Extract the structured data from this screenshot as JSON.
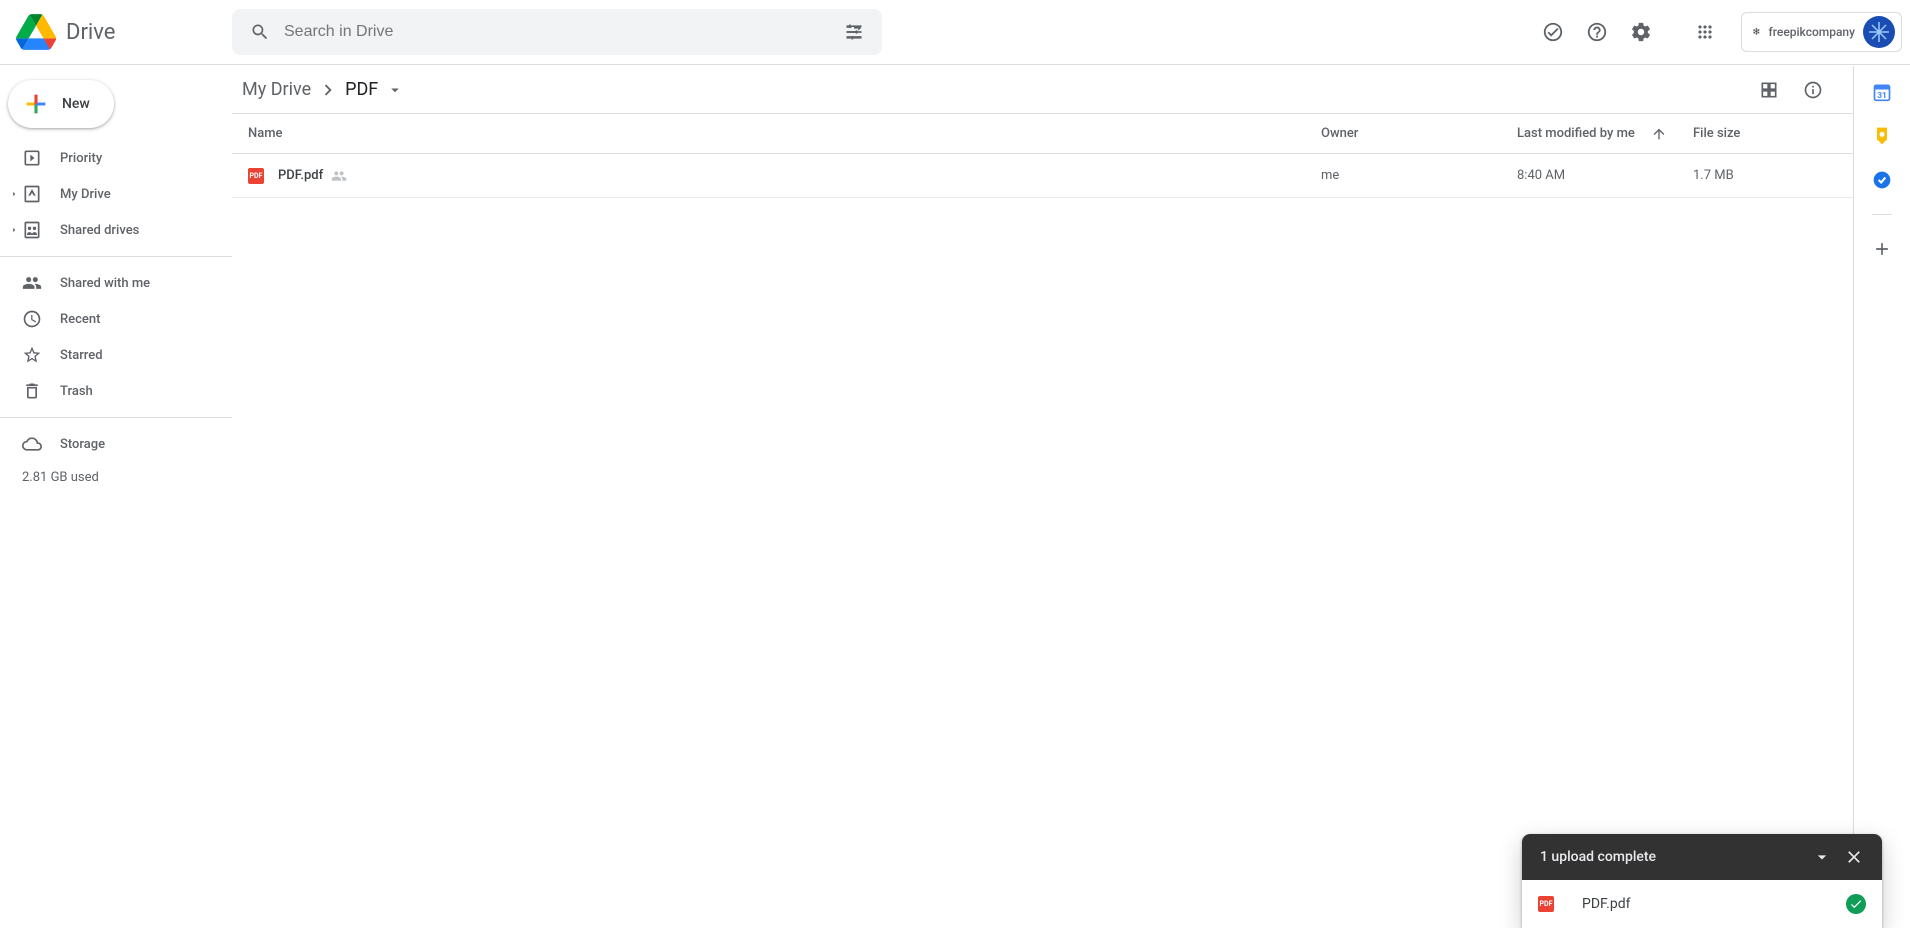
{
  "app_title": "Drive",
  "search": {
    "placeholder": "Search in Drive"
  },
  "org_label": "freepikcompany",
  "new_button": "New",
  "sidebar": {
    "items": [
      {
        "label": "Priority"
      },
      {
        "label": "My Drive"
      },
      {
        "label": "Shared drives"
      }
    ],
    "items2": [
      {
        "label": "Shared with me"
      },
      {
        "label": "Recent"
      },
      {
        "label": "Starred"
      },
      {
        "label": "Trash"
      }
    ],
    "storage_label": "Storage",
    "storage_used": "2.81 GB used"
  },
  "breadcrumb": {
    "root": "My Drive",
    "current": "PDF"
  },
  "columns": {
    "name": "Name",
    "owner": "Owner",
    "modified": "Last modified by me",
    "size": "File size"
  },
  "files": [
    {
      "name": "PDF.pdf",
      "owner": "me",
      "modified": "8:40 AM",
      "size": "1.7 MB"
    }
  ],
  "toast": {
    "title": "1 upload complete",
    "file": "PDF.pdf"
  }
}
